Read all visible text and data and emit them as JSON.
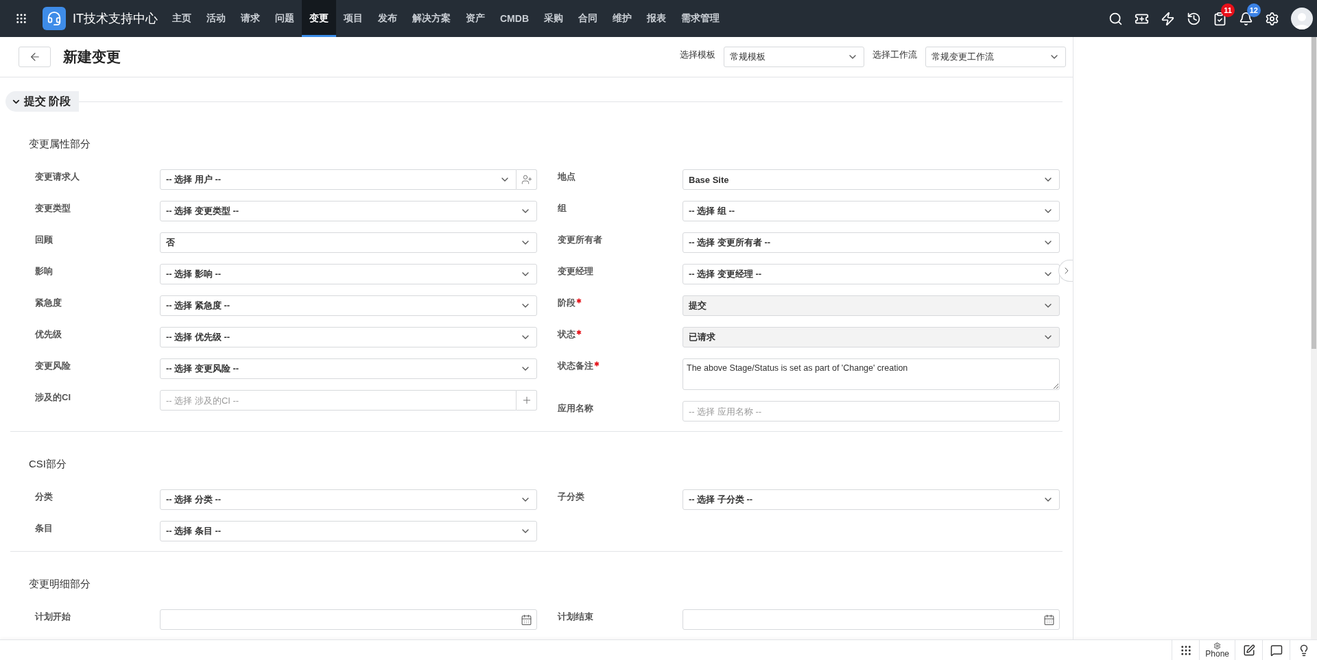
{
  "topbar": {
    "app_title": "IT技术支持中心",
    "nav": [
      {
        "label": "主页",
        "selected": false
      },
      {
        "label": "活动",
        "selected": false
      },
      {
        "label": "请求",
        "selected": false
      },
      {
        "label": "问题",
        "selected": false
      },
      {
        "label": "变更",
        "selected": true
      },
      {
        "label": "项目",
        "selected": false
      },
      {
        "label": "发布",
        "selected": false
      },
      {
        "label": "解决方案",
        "selected": false
      },
      {
        "label": "资产",
        "selected": false
      },
      {
        "label": "CMDB",
        "selected": false
      },
      {
        "label": "采购",
        "selected": false
      },
      {
        "label": "合同",
        "selected": false
      },
      {
        "label": "维护",
        "selected": false
      },
      {
        "label": "报表",
        "selected": false
      },
      {
        "label": "需求管理",
        "selected": false
      }
    ],
    "actions": [
      {
        "kind": "search"
      },
      {
        "kind": "ticket"
      },
      {
        "kind": "bolt"
      },
      {
        "kind": "history"
      },
      {
        "kind": "tasks",
        "badge": "11",
        "color": "#e8101a"
      },
      {
        "kind": "bell",
        "badge": "12",
        "color": "#3b82e6"
      },
      {
        "kind": "settings"
      },
      {
        "kind": "avatar"
      }
    ]
  },
  "header": {
    "title": "新建变更",
    "selectors": [
      {
        "label": "选择模板",
        "value": "常规模板"
      },
      {
        "label": "选择工作流",
        "value": "常规变更工作流"
      }
    ]
  },
  "stage": {
    "title": "提交 阶段",
    "expanded": true
  },
  "sections": [
    {
      "title": "变更属性部分",
      "columns": [
        [
          {
            "label": "变更请求人",
            "required": false,
            "kind": "select",
            "value": "-- 选择 用户 --",
            "disabled": false,
            "addon": {
              "kind": "user"
            }
          },
          {
            "label": "变更类型",
            "required": false,
            "kind": "select",
            "value": "-- 选择 变更类型 --",
            "disabled": false
          },
          {
            "label": "回顾",
            "required": false,
            "kind": "select",
            "value": "否",
            "disabled": false
          },
          {
            "label": "影响",
            "required": false,
            "kind": "select",
            "value": "-- 选择 影响 --",
            "disabled": false
          },
          {
            "label": "紧急度",
            "required": false,
            "kind": "select",
            "value": "-- 选择 紧急度 --",
            "disabled": false
          },
          {
            "label": "优先级",
            "required": false,
            "kind": "select",
            "value": "-- 选择 优先级 --",
            "disabled": false
          },
          {
            "label": "变更风险",
            "required": false,
            "kind": "select",
            "value": "-- 选择 变更风险 --",
            "disabled": false
          },
          {
            "label": "涉及的CI",
            "required": false,
            "kind": "lookup",
            "placeholder": "-- 选择 涉及的CI --",
            "disabled": false,
            "addon": {
              "kind": "plus"
            }
          }
        ],
        [
          {
            "label": "地点",
            "required": false,
            "kind": "select",
            "value": "Base Site",
            "disabled": false
          },
          {
            "label": "组",
            "required": false,
            "kind": "select",
            "value": "-- 选择 组 --",
            "disabled": false
          },
          {
            "label": "变更所有者",
            "required": false,
            "kind": "select",
            "value": "-- 选择 变更所有者 --",
            "disabled": false
          },
          {
            "label": "变更经理",
            "required": false,
            "kind": "select",
            "value": "-- 选择 变更经理 --",
            "disabled": false
          },
          {
            "label": "阶段",
            "required": true,
            "kind": "select",
            "value": "提交",
            "disabled": true
          },
          {
            "label": "状态",
            "required": true,
            "kind": "select",
            "value": "已请求",
            "disabled": true
          },
          {
            "label": "状态备注",
            "required": true,
            "kind": "textarea",
            "value": "The above Stage/Status is set as part of 'Change' creation",
            "disabled": false
          },
          {
            "label": "应用名称",
            "required": false,
            "kind": "lookup",
            "placeholder": "-- 选择 应用名称 --",
            "disabled": false
          }
        ]
      ]
    },
    {
      "title": "CSI部分",
      "columns": [
        [
          {
            "label": "分类",
            "required": false,
            "kind": "select",
            "value": "-- 选择 分类 --",
            "disabled": false
          },
          {
            "label": "条目",
            "required": false,
            "kind": "select",
            "value": "-- 选择 条目 --",
            "disabled": false
          }
        ],
        [
          {
            "label": "子分类",
            "required": false,
            "kind": "select",
            "value": "-- 选择 子分类 --",
            "disabled": false
          }
        ]
      ]
    },
    {
      "title": "变更明细部分",
      "columns": [
        [
          {
            "label": "计划开始",
            "required": false,
            "kind": "date",
            "disabled": false
          }
        ],
        [
          {
            "label": "计划结束",
            "required": false,
            "kind": "date",
            "disabled": false
          }
        ]
      ]
    }
  ],
  "footer": {
    "items": [
      {
        "kind": "dialpad"
      },
      {
        "kind": "phone",
        "label": "Phone"
      },
      {
        "kind": "note"
      },
      {
        "kind": "chat"
      },
      {
        "kind": "bulb"
      }
    ]
  }
}
